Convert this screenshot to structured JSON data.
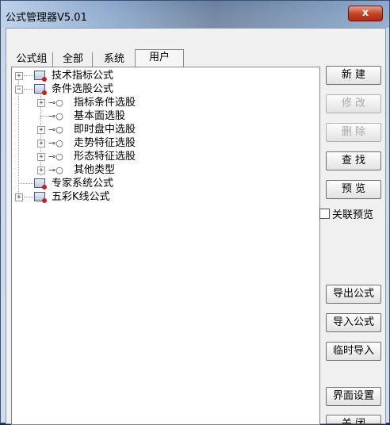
{
  "window": {
    "title": "公式管理器V5.01",
    "close_label": "x"
  },
  "tabs": [
    "公式组",
    "全部",
    "系统",
    "用户"
  ],
  "tree": {
    "tech": "技术指标公式",
    "cond": "条件选股公式",
    "cond_children": [
      "指标条件选股",
      "基本面选股",
      "即时盘中选股",
      "走势特征选股",
      "形态特征选股",
      "其他类型"
    ],
    "expert": "专家系统公式",
    "color": "五彩K线公式"
  },
  "buttons": {
    "new": "新 建",
    "modify": "修 改",
    "delete": "删 除",
    "find": "查 找",
    "preview": "预 览",
    "link_preview": "关联预览",
    "export": "导出公式",
    "import": "导入公式",
    "temp_import": "临时导入",
    "ui_settings": "界面设置",
    "close": "关 闭"
  }
}
